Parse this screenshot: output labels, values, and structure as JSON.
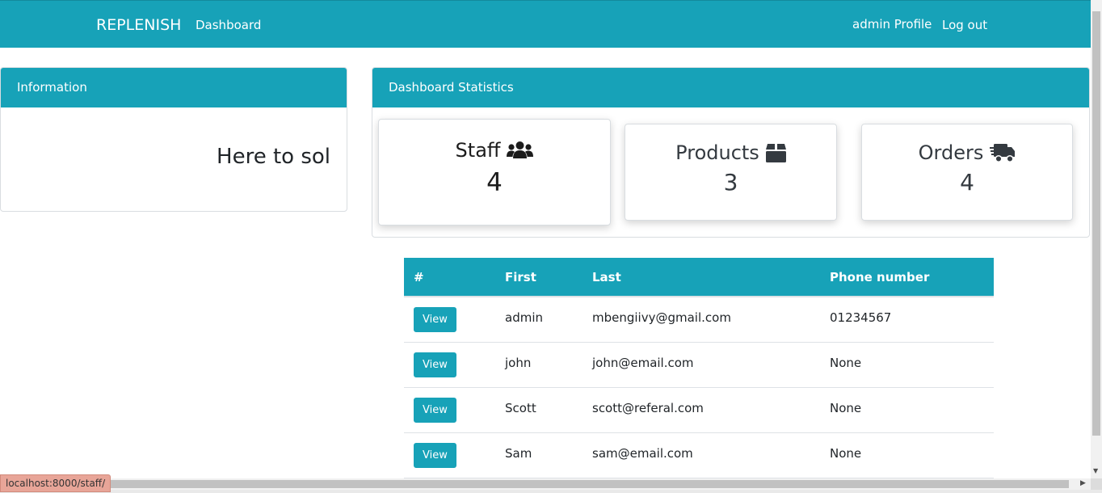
{
  "navbar": {
    "brand": "REPLENISH",
    "dashboard_link": "Dashboard",
    "profile_link": "admin Profile",
    "logout_link": "Log out"
  },
  "info_card": {
    "header": "Information",
    "text": "Here to sol"
  },
  "stats_card": {
    "header": "Dashboard Statistics",
    "stats": [
      {
        "label": "Staff",
        "value": "4",
        "icon": "users-icon"
      },
      {
        "label": "Products",
        "value": "3",
        "icon": "box-icon"
      },
      {
        "label": "Orders",
        "value": "4",
        "icon": "truck-icon"
      }
    ]
  },
  "table": {
    "headers": [
      "#",
      "First",
      "Last",
      "Phone number"
    ],
    "button_label": "View",
    "rows": [
      {
        "first": "admin",
        "last": "mbengiivy@gmail.com",
        "phone": "01234567"
      },
      {
        "first": "john",
        "last": "john@email.com",
        "phone": "None"
      },
      {
        "first": "Scott",
        "last": "scott@referal.com",
        "phone": "None"
      },
      {
        "first": "Sam",
        "last": "sam@email.com",
        "phone": "None"
      }
    ]
  },
  "status_url": "localhost:8000/staff/",
  "colors": {
    "primary": "#17a2b8",
    "status_bar": "#e8a598"
  }
}
